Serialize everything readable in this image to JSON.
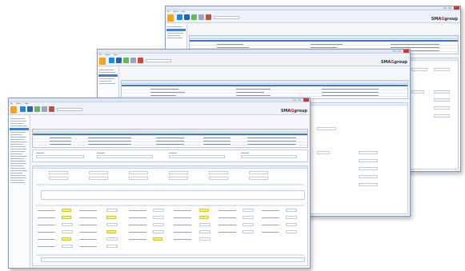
{
  "brand": {
    "logo_main": "SMA",
    "logo_accent": "G",
    "logo_tail": "group"
  },
  "windows": [
    {
      "id": "back",
      "menu": [
        "File",
        "Options",
        "Help"
      ]
    },
    {
      "id": "mid",
      "menu": [
        "File",
        "Options",
        "Help"
      ]
    },
    {
      "id": "front",
      "menu": [
        "File",
        "Options",
        "Help"
      ]
    }
  ],
  "ribbon_icons": [
    "home-icon",
    "save-icon",
    "save-as-icon",
    "print-icon",
    "settings-icon",
    "close-doc-icon"
  ],
  "colors": {
    "title_bar": "#dfe7f3",
    "close_button": "#d9342b",
    "selection": "#3b7ad1",
    "highlight_field": "#fff25a",
    "ribbon_home": "#f3a41d",
    "logo_accent": "#d8252c"
  }
}
